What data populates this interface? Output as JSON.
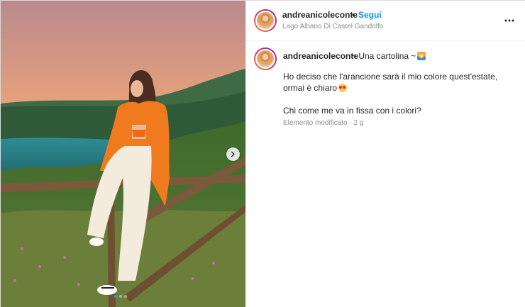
{
  "post": {
    "username": "andreanicoleconte",
    "separator": "•",
    "follow_label": "Segui",
    "location": "Lago Albano Di Castel Gandolfo"
  },
  "caption": {
    "username": "andreanicoleconte",
    "title": "~ Una cartolina ~",
    "line1": "Ho deciso che l'arancione sarà il mio colore quest'estate, ormai è chiaro",
    "line2": "Chi come me va in fissa con i colori?",
    "meta": "Elemento modificato · 2 g"
  },
  "carousel": {
    "total_slides": 3,
    "active_slide": 1
  },
  "icons": {
    "next": "chevron-right-icon",
    "more": "more-horizontal-icon",
    "title_emoji": "sunset-emoji-icon",
    "line1_emoji": "smiling-face-with-hearts-emoji-icon"
  },
  "colors": {
    "follow": "#0095f6",
    "meta": "#8e8e8e",
    "text": "#262626",
    "carousel_active_dot": "#3897f0"
  }
}
